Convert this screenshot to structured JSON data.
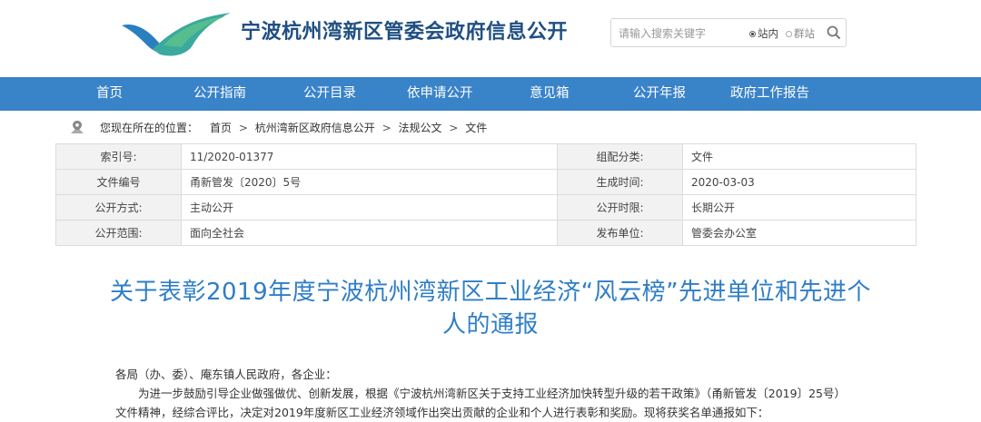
{
  "header": {
    "site_title": "宁波杭州湾新区管委会政府信息公开",
    "colors": {
      "title": "#1f4f82",
      "logo_teal": "#3aa99f",
      "logo_blue": "#2a7fc0",
      "logo_green": "#5cc28a"
    }
  },
  "search": {
    "placeholder": "请输入搜索关键字",
    "scope_site": "站内",
    "scope_group": "群站",
    "selected_scope": "站内",
    "button_icon": "search-icon"
  },
  "nav": {
    "color": "#3983c9",
    "items": [
      "首页",
      "公开指南",
      "公开目录",
      "依申请公开",
      "意见箱",
      "公开年报",
      "政府工作报告"
    ]
  },
  "breadcrumb": {
    "icon": "location-pin-icon",
    "label": "您现在所在的位置：",
    "items": [
      "首页",
      "杭州湾新区政府信息公开",
      "法规公文",
      "文件"
    ],
    "separator": ">"
  },
  "meta": {
    "rows": [
      {
        "k1": "索引号:",
        "v1": "11/2020-01377",
        "k2": "组配分类:",
        "v2": "文件"
      },
      {
        "k1": "文件编号",
        "v1": "甬新管发〔2020〕5号",
        "k2": "生成时间:",
        "v2": "2020-03-03"
      },
      {
        "k1": "公开方式:",
        "v1": "主动公开",
        "k2": "公开时限:",
        "v2": "长期公开"
      },
      {
        "k1": "公开范围:",
        "v1": "面向全社会",
        "k2": "发布单位:",
        "v2": "管委会办公室"
      }
    ]
  },
  "article": {
    "title_line1": "关于表彰2019年度宁波杭州湾新区工业经济“风云榜”先进单位和先进个",
    "title_line2": "人的通报",
    "title_color": "#2f7ec6",
    "salutation": "各局（办、委）、庵东镇人民政府，各企业：",
    "para1": "为进一步鼓励引导企业做强做优、创新发展，根据《宁波杭州湾新区关于支持工业经济加快转型升级的若干政策》（甬新管发〔2019〕25号）文件精神，经综合评比，决定对2019年度新区工业经济领域作出突出贡献的企业和个人进行表彰和奖励。现将获奖名单通报如下："
  }
}
